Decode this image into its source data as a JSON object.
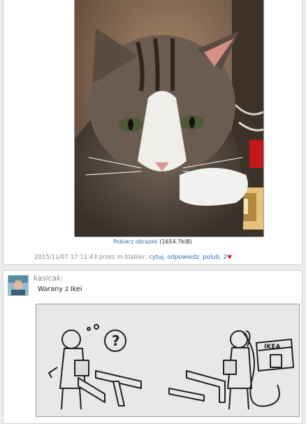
{
  "post1": {
    "download_link": "Pobierz obrazek",
    "file_size": "(1654.7kiB)",
    "timestamp": "2015/11/07 17:11:43",
    "by_label": "przez",
    "author": "m.blabler",
    "actions": {
      "quote": "cytuj",
      "reply": "odpowiedz",
      "like": "polub"
    },
    "like_count": "2",
    "heart": "♥"
  },
  "post2": {
    "username": "kasicak:",
    "text": "Warany z Ikei",
    "ikea_brand": "IKEA",
    "question_mark": "?"
  }
}
